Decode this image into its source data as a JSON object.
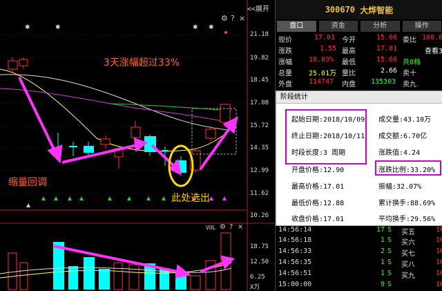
{
  "chart_header": {
    "expand_label": "<<展开"
  },
  "price_axis": [
    "21.18",
    "19.82",
    "18.45",
    "17.08",
    "15.72",
    "14.35",
    "12.99",
    "11.62",
    "10.26"
  ],
  "annotations": {
    "top": "3天涨幅超过33%",
    "left": "缩量回调",
    "bottom": "此处选出"
  },
  "volume_axis": {
    "title": "VOL",
    "ticks": [
      "18.75",
      "12.50",
      "6.25"
    ],
    "unit": "X万"
  },
  "stock": {
    "code": "300670",
    "name": "大烨智能"
  },
  "tabs": [
    {
      "label": "盘口",
      "active": true
    },
    {
      "label": "资金",
      "active": false
    },
    {
      "label": "分析",
      "active": false
    },
    {
      "label": "操作",
      "active": false
    }
  ],
  "quote": {
    "rows": [
      {
        "l1": "现价",
        "v1": "17.01",
        "l2": "今开",
        "v2": "15.66",
        "l3": "委比",
        "v3": "100.0"
      },
      {
        "l1": "涨跌",
        "v1": "1.55",
        "l2": "最高",
        "v2": "17.01",
        "l3": "",
        "v3": "查看3"
      },
      {
        "l1": "涨幅",
        "v1": "10.03%",
        "l2": "最低",
        "v2": "15.66",
        "l3": "共0档",
        "v3": ""
      },
      {
        "l1": "总量",
        "v1": "25.01万",
        "l2": "量比",
        "v2": "2.66",
        "l3": "卖十",
        "v3": ""
      },
      {
        "l1": "外盘",
        "v1": "114747",
        "l2": "内盘",
        "v2": "135303",
        "l3": "卖九",
        "v3": ""
      }
    ]
  },
  "popup": {
    "title": "阶段统计",
    "start_date": "起始日期:2018/10/09",
    "end_date": "终止日期:2018/10/11",
    "period": "时段长度:3 周期",
    "volume": "成交量:43.10万",
    "amount": "成交额:6.70亿",
    "change_value": "涨跌值:4.24",
    "change_ratio": "涨跌比例:33.20%",
    "open_price": "开盘价格:12.90",
    "high_price": "最高价格:17.01",
    "low_price": "最低价格:12.88",
    "close_price": "收盘价格:17.01",
    "amplitude": "振幅:32.07%",
    "cum_turnover": "累计换手:88.69%",
    "avg_turnover": "平均换手:29.56%"
  },
  "ticks": [
    {
      "time": "14:56:14",
      "vol": "17",
      "flag": "S",
      "side": "买五",
      "price": "16"
    },
    {
      "time": "14:56:18",
      "vol": "1",
      "flag": "S",
      "side": "买六",
      "price": "16"
    },
    {
      "time": "14:56:33",
      "vol": "2",
      "flag": "S",
      "side": "买七",
      "price": "16"
    },
    {
      "time": "14:56:35",
      "vol": "1",
      "flag": "S",
      "side": "买八",
      "price": "16"
    },
    {
      "time": "14:56:51",
      "vol": "1",
      "flag": "S",
      "side": "买九",
      "price": "16"
    },
    {
      "time": "15:00:00",
      "vol": "9",
      "flag": "S",
      "side": "",
      "price": "16"
    }
  ],
  "colors": {
    "up": "#ff3333",
    "down": "#00ffff",
    "magenta": "#ff33ff",
    "ma_white": "#ffffff",
    "ma_yellow": "#ffff66",
    "ma_magenta": "#cc44cc",
    "ma_green": "#33cc33"
  }
}
